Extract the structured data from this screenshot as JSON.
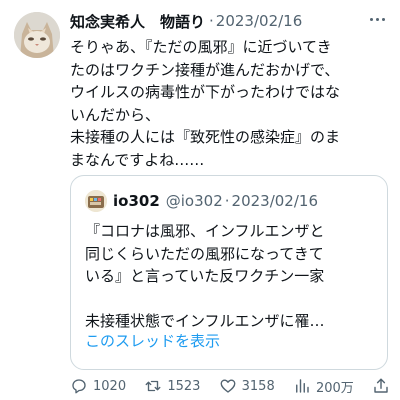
{
  "tweet": {
    "author_name": "知念実希人　物語り",
    "separator": "·",
    "date": "2023/02/16",
    "text_lines": [
      "そりゃあ、『ただの風邪』に近づいてき",
      "たのはワクチン接種が進んだおかげで、",
      "ウイルスの病毒性が下がったわけではな",
      "いんだから、",
      "未接種の人には『致死性の感染症』のま",
      "まなんですよね……"
    ],
    "icons": {
      "more": "more-dots-icon",
      "avatar": "cat-avatar"
    }
  },
  "quote": {
    "author_name": "io302",
    "handle": "@io302",
    "separator": "·",
    "date": "2023/02/16",
    "text_lines": [
      "『コロナは風邪、インフルエンザと",
      "同じくらいただの風邪になってきて",
      "いる』と言っていた反ワクチン一家"
    ],
    "truncated_line": "未接種状態でインフルエンザに罹…",
    "show_thread": "このスレッドを表示"
  },
  "actions": {
    "reply": "1020",
    "retweet": "1523",
    "like": "3158",
    "views": "200万"
  },
  "colors": {
    "text": "#0f1419",
    "muted": "#536471",
    "link": "#1d9bf0",
    "border": "#cfd9de"
  }
}
